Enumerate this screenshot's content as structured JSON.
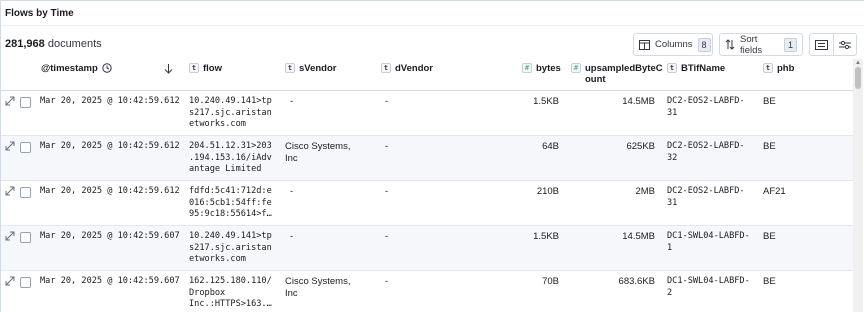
{
  "panel": {
    "title": "Flows by Time"
  },
  "summary": {
    "count": "281,968",
    "label": "documents"
  },
  "toolbar": {
    "columns_label": "Columns",
    "columns_count": "8",
    "sort_label": "Sort fields",
    "sort_count": "1"
  },
  "columns": {
    "timestamp": "@timestamp",
    "flow": "flow",
    "svendor": "sVendor",
    "dvendor": "dVendor",
    "bytes": "bytes",
    "upsampled_l1": "upsampledByteC",
    "upsampled_l2": "ount",
    "btifname": "BTifName",
    "phb": "phb",
    "type_text": "t",
    "type_num": "#"
  },
  "rows": [
    {
      "timestamp": "Mar 20, 2025 @ 10:42:59.612",
      "flow": [
        "10.240.49.141>tp",
        "s217.sjc.aristan",
        "etworks.com"
      ],
      "svendor": [
        "-"
      ],
      "dvendor": "-",
      "bytes": "1.5KB",
      "upsampled": "14.5MB",
      "btifname": [
        "DC2-EOS2-LABFD-",
        "31"
      ],
      "phb": "BE"
    },
    {
      "timestamp": "Mar 20, 2025 @ 10:42:59.612",
      "flow": [
        "204.51.12.31>203",
        ".194.153.16/iAdv",
        "antage Limited"
      ],
      "svendor": [
        "Cisco Systems,",
        "Inc"
      ],
      "dvendor": "-",
      "bytes": "64B",
      "upsampled": "625KB",
      "btifname": [
        "DC2-EOS2-LABFD-",
        "32"
      ],
      "phb": "BE"
    },
    {
      "timestamp": "Mar 20, 2025 @ 10:42:59.612",
      "flow": [
        "fdfd:5c41:712d:e",
        "016:5cb1:54ff:fe",
        "95:9c18:55614>f…"
      ],
      "svendor": [
        "-"
      ],
      "dvendor": "-",
      "bytes": "210B",
      "upsampled": "2MB",
      "btifname": [
        "DC2-EOS2-LABFD-",
        "31"
      ],
      "phb": "AF21"
    },
    {
      "timestamp": "Mar 20, 2025 @ 10:42:59.607",
      "flow": [
        "10.240.49.141>tp",
        "s217.sjc.aristan",
        "etworks.com"
      ],
      "svendor": [
        "-"
      ],
      "dvendor": "-",
      "bytes": "1.5KB",
      "upsampled": "14.5MB",
      "btifname": [
        "DC1-SWL04-LABFD-",
        "1"
      ],
      "phb": "BE"
    },
    {
      "timestamp": "Mar 20, 2025 @ 10:42:59.607",
      "flow": [
        "162.125.180.110/",
        "Dropbox",
        "Inc.:HTTPS>163.…"
      ],
      "svendor": [
        "Cisco Systems,",
        "Inc"
      ],
      "dvendor": "-",
      "bytes": "70B",
      "upsampled": "683.6KB",
      "btifname": [
        "DC1-SWL04-LABFD-",
        "2"
      ],
      "phb": "BE"
    }
  ],
  "icons": [
    "expand-icon",
    "clock-icon",
    "sort-arrow-down-icon",
    "columns-icon",
    "sort-fields-icon",
    "density-icon",
    "settings-icon"
  ]
}
